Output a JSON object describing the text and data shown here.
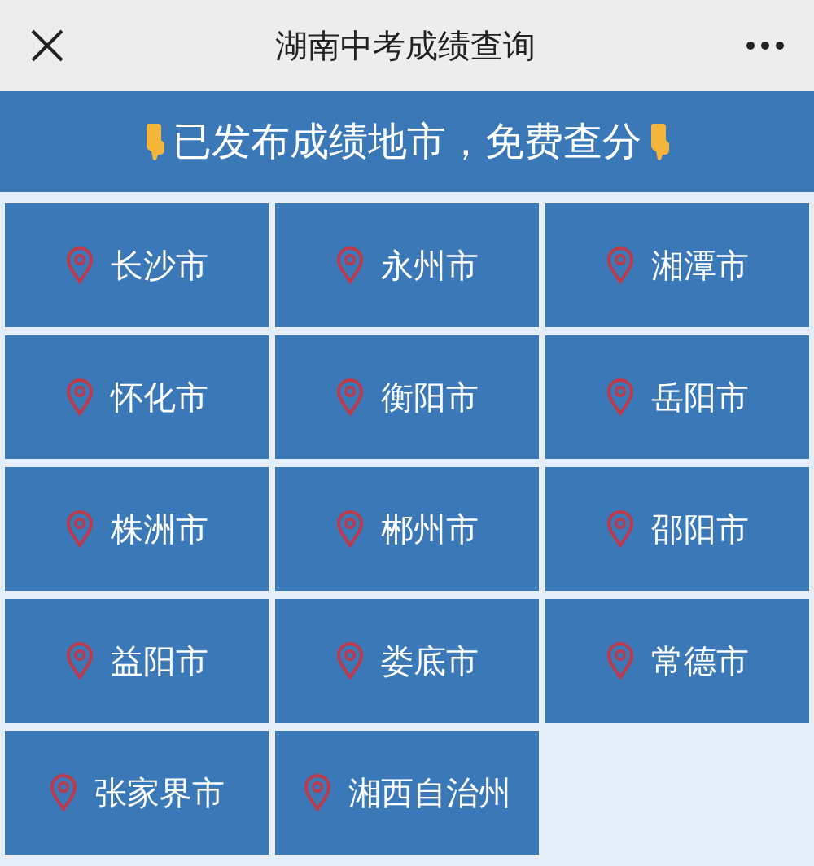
{
  "window": {
    "title": "湖南中考成绩查询"
  },
  "banner": {
    "text": "已发布成绩地市，免费查分"
  },
  "cities": [
    {
      "name": "长沙市"
    },
    {
      "name": "永州市"
    },
    {
      "name": "湘潭市"
    },
    {
      "name": "怀化市"
    },
    {
      "name": "衡阳市"
    },
    {
      "name": "岳阳市"
    },
    {
      "name": "株洲市"
    },
    {
      "name": "郴州市"
    },
    {
      "name": "邵阳市"
    },
    {
      "name": "益阳市"
    },
    {
      "name": "娄底市"
    },
    {
      "name": "常德市"
    },
    {
      "name": "张家界市"
    },
    {
      "name": "湘西自治州"
    }
  ]
}
